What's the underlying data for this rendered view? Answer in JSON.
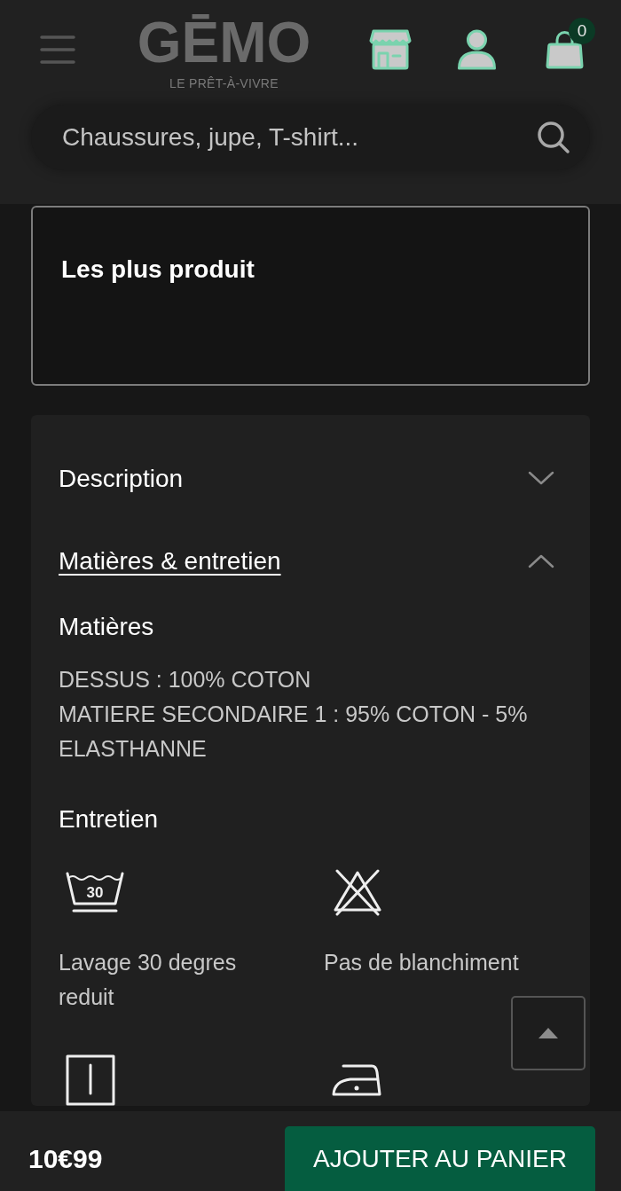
{
  "header": {
    "logo": {
      "brand": "GĒMO",
      "tagline": "LE PRÊT-À-VIVRE"
    },
    "cart_count": "0",
    "search": {
      "placeholder": "Chaussures, jupe, T-shirt..."
    }
  },
  "highlights_panel": {
    "title": "Les plus produit"
  },
  "accordion": [
    {
      "title": "Description",
      "expanded": false
    },
    {
      "title": "Matières & entretien",
      "expanded": true,
      "materials": {
        "heading": "Matières",
        "lines": [
          "DESSUS : 100% COTON",
          "MATIERE SECONDAIRE 1 : 95% COTON - 5% ELASTHANNE"
        ]
      },
      "care": {
        "heading": "Entretien",
        "items": [
          {
            "kind": "wash",
            "temperature": "30",
            "label": "Lavage 30 degres reduit"
          },
          {
            "kind": "no-bleach",
            "label": "Pas de blanchiment"
          },
          {
            "kind": "line-dry"
          },
          {
            "kind": "iron"
          }
        ]
      }
    }
  ],
  "bottom_bar": {
    "price": "10€99",
    "add_to_cart": "AJOUTER AU PANIER"
  }
}
